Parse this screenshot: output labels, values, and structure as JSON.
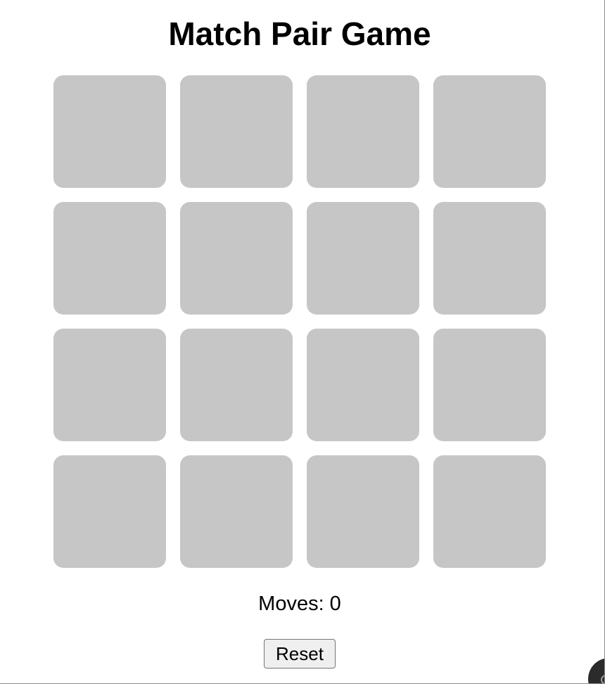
{
  "game": {
    "title": "Match Pair Game",
    "moves_text": "Moves: 0",
    "moves": 0,
    "reset_label": "Reset",
    "rows": 4,
    "columns": 4,
    "cards": [
      {
        "state": "face-down"
      },
      {
        "state": "face-down"
      },
      {
        "state": "face-down"
      },
      {
        "state": "face-down"
      },
      {
        "state": "face-down"
      },
      {
        "state": "face-down"
      },
      {
        "state": "face-down"
      },
      {
        "state": "face-down"
      },
      {
        "state": "face-down"
      },
      {
        "state": "face-down"
      },
      {
        "state": "face-down"
      },
      {
        "state": "face-down"
      },
      {
        "state": "face-down"
      },
      {
        "state": "face-down"
      },
      {
        "state": "face-down"
      },
      {
        "state": "face-down"
      }
    ]
  },
  "colors": {
    "card_back": "#c6c6c6",
    "background": "#ffffff",
    "button_background": "#efefef"
  },
  "icons": {
    "corner_badge": "chat-bubble-icon"
  }
}
